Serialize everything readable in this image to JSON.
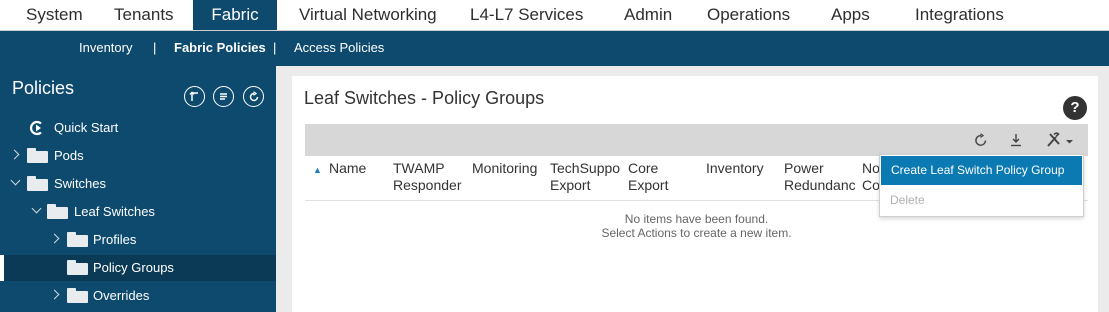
{
  "top_nav": {
    "tabs": [
      "System",
      "Tenants",
      "Fabric",
      "Virtual Networking",
      "L4-L7 Services",
      "Admin",
      "Operations",
      "Apps",
      "Integrations"
    ],
    "active": "Fabric"
  },
  "sub_nav": {
    "items": [
      "Inventory",
      "|",
      "Fabric Policies",
      "|",
      "Access Policies"
    ]
  },
  "sidebar": {
    "title": "Policies",
    "tree": [
      {
        "label": "Quick Start"
      },
      {
        "label": "Pods"
      },
      {
        "label": "Switches"
      },
      {
        "label": "Leaf Switches"
      },
      {
        "label": "Profiles"
      },
      {
        "label": "Policy Groups"
      },
      {
        "label": "Overrides"
      }
    ]
  },
  "main": {
    "title": "Leaf Switches - Policy Groups",
    "help": "?",
    "columns": [
      [
        "Name"
      ],
      [
        "TWAMP",
        "Responder"
      ],
      [
        "Monitoring"
      ],
      [
        "TechSupport",
        "Export"
      ],
      [
        "Core",
        "Export"
      ],
      [
        "Inventory"
      ],
      [
        "Power",
        "Redundancy"
      ],
      [
        "No",
        "Co"
      ]
    ],
    "sort_indicator": "▲",
    "empty_line1": "No items have been found.",
    "empty_line2": "Select Actions to create a new item."
  },
  "menu": {
    "items": [
      "Create Leaf Switch Policy Group",
      "Delete"
    ]
  },
  "colors": {
    "nav_blue": "#0e4a6e",
    "menu_highlight": "#0b7ab2"
  }
}
